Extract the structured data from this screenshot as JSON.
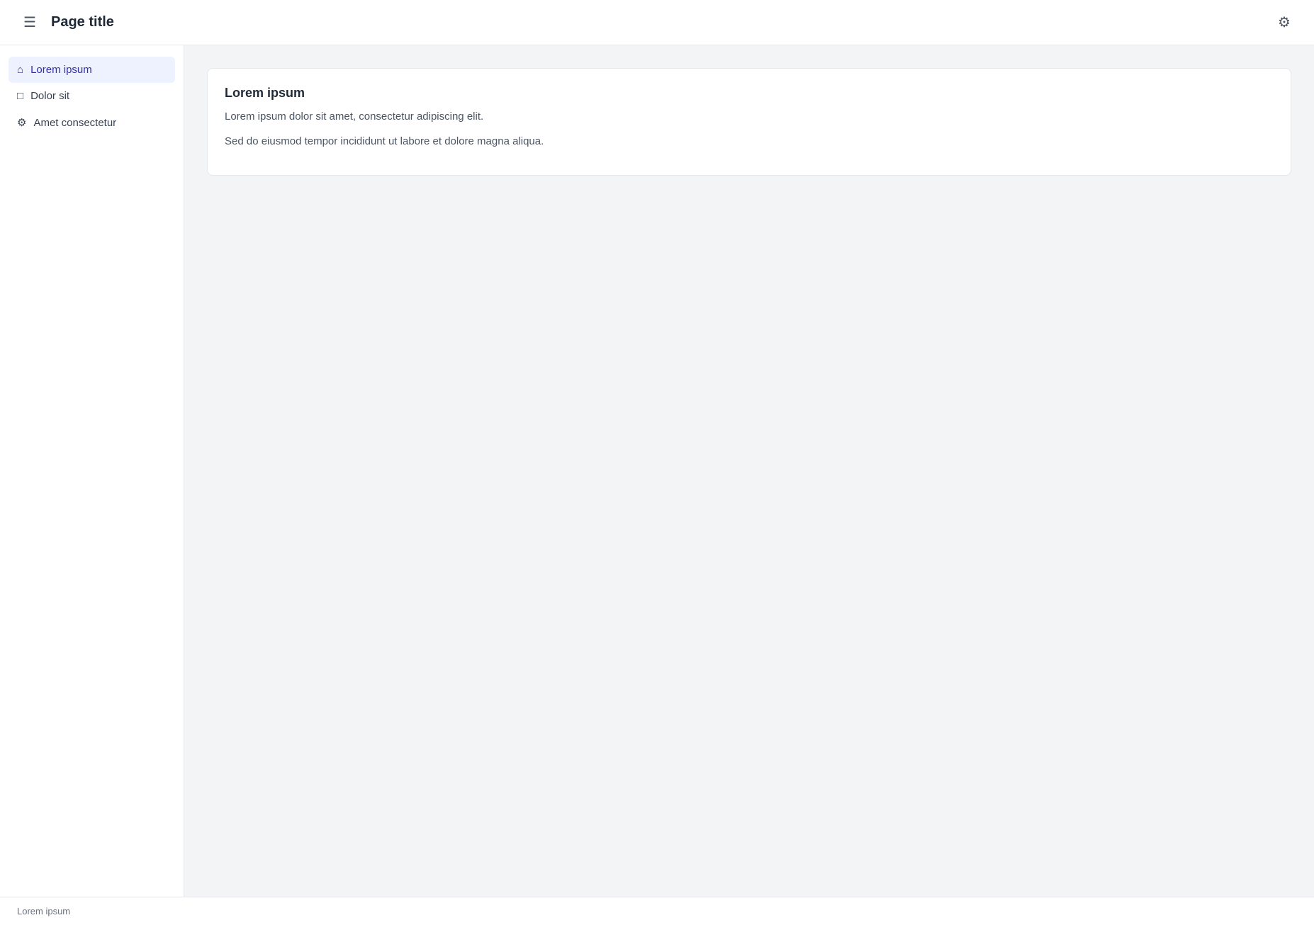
{
  "header": {
    "title": "Page title",
    "menu_icon": "menu-icon",
    "settings_icon": "gear-icon"
  },
  "sidebar": {
    "items": [
      {
        "label": "Lorem ipsum",
        "icon": "home-icon"
      },
      {
        "label": "Dolor sit",
        "icon": "folder-icon"
      },
      {
        "label": "Amet consectetur",
        "icon": "gear-icon"
      }
    ]
  },
  "main": {
    "heading": "Lorem ipsum",
    "paragraphs": [
      "Lorem ipsum dolor sit amet, consectetur adipiscing elit.",
      "Sed do eiusmod tempor incididunt ut labore et dolore magna aliqua."
    ]
  },
  "footer": {
    "text": "Lorem ipsum"
  }
}
